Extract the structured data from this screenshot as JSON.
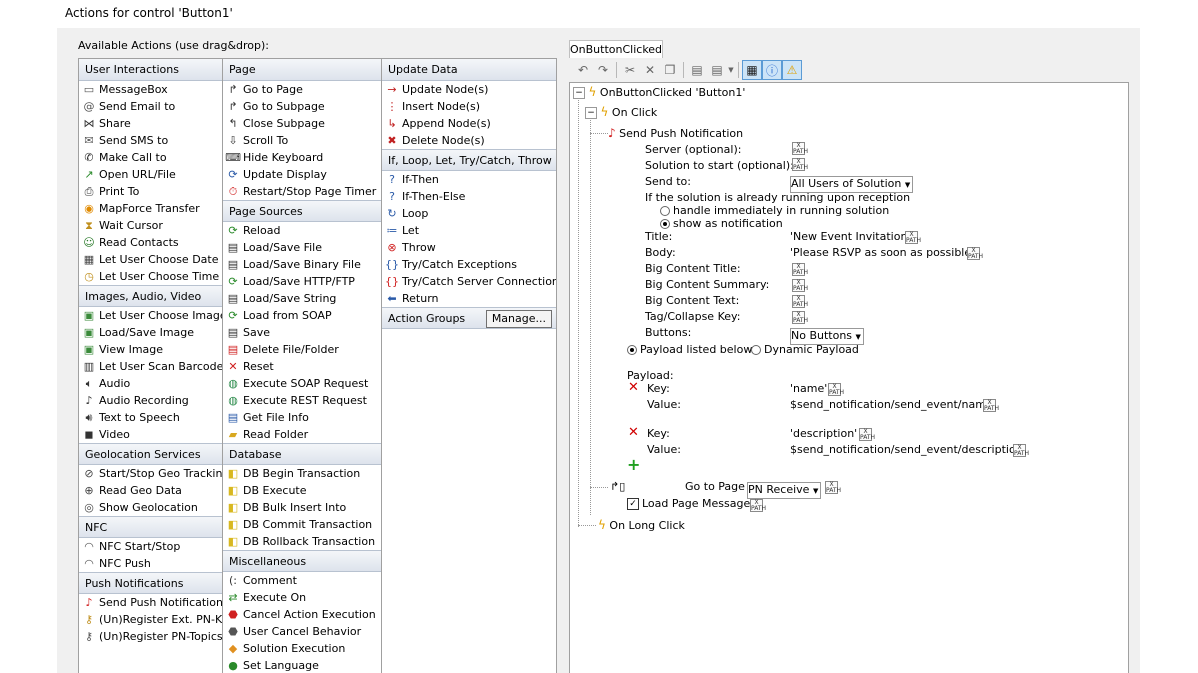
{
  "window_title": "Actions for control 'Button1'",
  "available_label": "Available Actions (use drag&drop):",
  "col1": [
    {
      "type": "group",
      "label": "User Interactions"
    },
    {
      "type": "item",
      "label": "MessageBox",
      "icon": "message-box-icon",
      "glyph": "▭",
      "color": "#555"
    },
    {
      "type": "item",
      "label": "Send Email to",
      "icon": "at-sign-icon",
      "glyph": "@",
      "color": "#555"
    },
    {
      "type": "item",
      "label": "Share",
      "icon": "share-icon",
      "glyph": "⋈",
      "color": "#333"
    },
    {
      "type": "item",
      "label": "Send SMS to",
      "icon": "sms-envelope-icon",
      "glyph": "✉",
      "color": "#555"
    },
    {
      "type": "item",
      "label": "Make Call to",
      "icon": "phone-icon",
      "glyph": "✆",
      "color": "#222"
    },
    {
      "type": "item",
      "label": "Open URL/File",
      "icon": "open-url-icon",
      "glyph": "↗",
      "color": "#2a8a2a"
    },
    {
      "type": "item",
      "label": "Print To",
      "icon": "printer-icon",
      "glyph": "⎙",
      "color": "#333"
    },
    {
      "type": "item",
      "label": "MapForce Transfer",
      "icon": "mapforce-icon",
      "glyph": "◉",
      "color": "#e08a00"
    },
    {
      "type": "item",
      "label": "Wait Cursor",
      "icon": "hourglass-icon",
      "glyph": "⧗",
      "color": "#c09020"
    },
    {
      "type": "item",
      "label": "Read Contacts",
      "icon": "contacts-icon",
      "glyph": "☺",
      "color": "#2a7a2a"
    },
    {
      "type": "item",
      "label": "Let User Choose Date",
      "icon": "calendar-icon",
      "glyph": "▦",
      "color": "#444"
    },
    {
      "type": "item",
      "label": "Let User Choose Time",
      "icon": "clock-icon",
      "glyph": "◷",
      "color": "#c09020"
    },
    {
      "type": "group",
      "label": "Images, Audio, Video"
    },
    {
      "type": "item",
      "label": "Let User Choose Image",
      "icon": "image-icon",
      "glyph": "▣",
      "color": "#3a8a3a"
    },
    {
      "type": "item",
      "label": "Load/Save Image",
      "icon": "image-save-icon",
      "glyph": "▣",
      "color": "#3a8a3a"
    },
    {
      "type": "item",
      "label": "View Image",
      "icon": "view-image-icon",
      "glyph": "▣",
      "color": "#3a8a3a"
    },
    {
      "type": "item",
      "label": "Let User Scan Barcode",
      "icon": "barcode-icon",
      "glyph": "▥",
      "color": "#333"
    },
    {
      "type": "item",
      "label": "Audio",
      "icon": "speaker-icon",
      "glyph": "🔈︎",
      "color": "#333"
    },
    {
      "type": "item",
      "label": "Audio Recording",
      "icon": "microphone-icon",
      "glyph": "♪",
      "color": "#333"
    },
    {
      "type": "item",
      "label": "Text to Speech",
      "icon": "speech-icon",
      "glyph": "🔊︎",
      "color": "#333"
    },
    {
      "type": "item",
      "label": "Video",
      "icon": "video-camera-icon",
      "glyph": "◼",
      "color": "#333"
    },
    {
      "type": "group",
      "label": "Geolocation Services"
    },
    {
      "type": "item",
      "label": "Start/Stop Geo Tracking",
      "icon": "geo-tracking-icon",
      "glyph": "⊘",
      "color": "#444"
    },
    {
      "type": "item",
      "label": "Read Geo Data",
      "icon": "geo-data-icon",
      "glyph": "⊕",
      "color": "#444"
    },
    {
      "type": "item",
      "label": "Show Geolocation",
      "icon": "geolocation-icon",
      "glyph": "◎",
      "color": "#444"
    },
    {
      "type": "group",
      "label": "NFC"
    },
    {
      "type": "item",
      "label": "NFC Start/Stop",
      "icon": "nfc-icon",
      "glyph": "◠",
      "color": "#555"
    },
    {
      "type": "item",
      "label": "NFC Push",
      "icon": "nfc-push-icon",
      "glyph": "◠",
      "color": "#555"
    },
    {
      "type": "group",
      "label": "Push Notifications"
    },
    {
      "type": "item",
      "label": "Send Push Notification",
      "icon": "bell-icon",
      "glyph": "♪",
      "color": "#d02020"
    },
    {
      "type": "item",
      "label": "(Un)Register Ext. PN-Key",
      "icon": "register-key-icon",
      "glyph": "⚷",
      "color": "#c09020"
    },
    {
      "type": "item",
      "label": "(Un)Register PN-Topics",
      "icon": "register-topics-icon",
      "glyph": "⚷",
      "color": "#555"
    }
  ],
  "col2": [
    {
      "type": "group",
      "label": "Page"
    },
    {
      "type": "item",
      "label": "Go to Page",
      "icon": "go-to-page-icon",
      "glyph": "↱",
      "color": "#333"
    },
    {
      "type": "item",
      "label": "Go to Subpage",
      "icon": "go-to-subpage-icon",
      "glyph": "↱",
      "color": "#333"
    },
    {
      "type": "item",
      "label": "Close Subpage",
      "icon": "close-subpage-icon",
      "glyph": "↰",
      "color": "#333"
    },
    {
      "type": "item",
      "label": "Scroll To",
      "icon": "scroll-icon",
      "glyph": "⇩",
      "color": "#333"
    },
    {
      "type": "item",
      "label": "Hide Keyboard",
      "icon": "keyboard-icon",
      "glyph": "⌨",
      "color": "#333"
    },
    {
      "type": "item",
      "label": "Update Display",
      "icon": "update-display-icon",
      "glyph": "⟳",
      "color": "#2a5aa8"
    },
    {
      "type": "item",
      "label": "Restart/Stop Page Timer",
      "icon": "timer-icon",
      "glyph": "⏱",
      "color": "#d02020"
    },
    {
      "type": "group",
      "label": "Page Sources"
    },
    {
      "type": "item",
      "label": "Reload",
      "icon": "reload-icon",
      "glyph": "⟳",
      "color": "#2a8a2a"
    },
    {
      "type": "item",
      "label": "Load/Save File",
      "icon": "save-file-icon",
      "glyph": "▤",
      "color": "#333"
    },
    {
      "type": "item",
      "label": "Load/Save Binary File",
      "icon": "binary-file-icon",
      "glyph": "▤",
      "color": "#333"
    },
    {
      "type": "item",
      "label": "Load/Save HTTP/FTP",
      "icon": "http-icon",
      "glyph": "⟳",
      "color": "#2a8a2a"
    },
    {
      "type": "item",
      "label": "Load/Save String",
      "icon": "string-icon",
      "glyph": "▤",
      "color": "#333"
    },
    {
      "type": "item",
      "label": "Load from SOAP",
      "icon": "soap-icon",
      "glyph": "⟳",
      "color": "#2a8a2a"
    },
    {
      "type": "item",
      "label": "Save",
      "icon": "save-icon",
      "glyph": "▤",
      "color": "#333"
    },
    {
      "type": "item",
      "label": "Delete File/Folder",
      "icon": "delete-file-icon",
      "glyph": "▤",
      "color": "#d02020"
    },
    {
      "type": "item",
      "label": "Reset",
      "icon": "reset-icon",
      "glyph": "✕",
      "color": "#d02020"
    },
    {
      "type": "item",
      "label": "Execute SOAP Request",
      "icon": "globe-icon",
      "glyph": "◍",
      "color": "#2a8a4a"
    },
    {
      "type": "item",
      "label": "Execute REST Request",
      "icon": "globe-rest-icon",
      "glyph": "◍",
      "color": "#2a8a4a"
    },
    {
      "type": "item",
      "label": "Get File Info",
      "icon": "file-info-icon",
      "glyph": "▤",
      "color": "#2a5aa8"
    },
    {
      "type": "item",
      "label": "Read Folder",
      "icon": "folder-icon",
      "glyph": "▰",
      "color": "#d8a820"
    },
    {
      "type": "group",
      "label": "Database"
    },
    {
      "type": "item",
      "label": "DB Begin Transaction",
      "icon": "db-begin-icon",
      "glyph": "◧",
      "color": "#d8b820"
    },
    {
      "type": "item",
      "label": "DB Execute",
      "icon": "db-execute-icon",
      "glyph": "◧",
      "color": "#d8b820"
    },
    {
      "type": "item",
      "label": "DB Bulk Insert Into",
      "icon": "db-bulk-icon",
      "glyph": "◧",
      "color": "#d8b820"
    },
    {
      "type": "item",
      "label": "DB Commit Transaction",
      "icon": "db-commit-icon",
      "glyph": "◧",
      "color": "#d8b820"
    },
    {
      "type": "item",
      "label": "DB Rollback Transaction",
      "icon": "db-rollback-icon",
      "glyph": "◧",
      "color": "#d8b820"
    },
    {
      "type": "group",
      "label": "Miscellaneous"
    },
    {
      "type": "item",
      "label": "Comment",
      "icon": "comment-icon",
      "glyph": "(:",
      "color": "#333"
    },
    {
      "type": "item",
      "label": "Execute On",
      "icon": "execute-on-icon",
      "glyph": "⇄",
      "color": "#2a8a2a"
    },
    {
      "type": "item",
      "label": "Cancel Action Execution",
      "icon": "cancel-icon",
      "glyph": "⬣",
      "color": "#d02020"
    },
    {
      "type": "item",
      "label": "User Cancel Behavior",
      "icon": "user-cancel-icon",
      "glyph": "⬣",
      "color": "#555"
    },
    {
      "type": "item",
      "label": "Solution Execution",
      "icon": "solution-icon",
      "glyph": "◆",
      "color": "#e09020"
    },
    {
      "type": "item",
      "label": "Set Language",
      "icon": "language-icon",
      "glyph": "●",
      "color": "#2a8a2a"
    }
  ],
  "col3": [
    {
      "type": "group",
      "label": "Update Data"
    },
    {
      "type": "item",
      "label": "Update Node(s)",
      "icon": "update-node-icon",
      "glyph": "→",
      "color": "#c02020"
    },
    {
      "type": "item",
      "label": "Insert Node(s)",
      "icon": "insert-node-icon",
      "glyph": "⋮",
      "color": "#c02020"
    },
    {
      "type": "item",
      "label": "Append Node(s)",
      "icon": "append-node-icon",
      "glyph": "↳",
      "color": "#c02020"
    },
    {
      "type": "item",
      "label": "Delete Node(s)",
      "icon": "delete-node-icon",
      "glyph": "✖",
      "color": "#c02020"
    },
    {
      "type": "group",
      "label": "If, Loop, Let, Try/Catch, Throw"
    },
    {
      "type": "item",
      "label": "If-Then",
      "icon": "question-icon",
      "glyph": "?",
      "color": "#2a5aa8"
    },
    {
      "type": "item",
      "label": "If-Then-Else",
      "icon": "question-else-icon",
      "glyph": "?",
      "color": "#2a5aa8"
    },
    {
      "type": "item",
      "label": "Loop",
      "icon": "loop-icon",
      "glyph": "↻",
      "color": "#2a5aa8"
    },
    {
      "type": "item",
      "label": "Let",
      "icon": "let-icon",
      "glyph": "≔",
      "color": "#2a5aa8"
    },
    {
      "type": "item",
      "label": "Throw",
      "icon": "throw-icon",
      "glyph": "⊗",
      "color": "#d02020"
    },
    {
      "type": "item",
      "label": "Try/Catch Exceptions",
      "icon": "try-catch-icon",
      "glyph": "{}",
      "color": "#2a5aa8"
    },
    {
      "type": "item",
      "label": "Try/Catch Server Connection",
      "icon": "try-catch-server-icon",
      "glyph": "{}",
      "color": "#d02020"
    },
    {
      "type": "item",
      "label": "Return",
      "icon": "return-icon",
      "glyph": "⬅",
      "color": "#2a5aa8"
    },
    {
      "type": "group",
      "label": "Action Groups",
      "button": "Manage..."
    }
  ],
  "editor": {
    "tab": "OnButtonClicked",
    "root": "OnButtonClicked 'Button1'",
    "on_click": "On Click",
    "send_push": "Send Push Notification",
    "server_label": "Server (optional):",
    "solution_label": "Solution to start (optional):",
    "send_to_label": "Send to:",
    "send_to_value": "All Users of Solution",
    "running_label": "If the solution is already running upon reception",
    "handle_label": "handle immediately in running solution",
    "show_label": "show as notification",
    "title_label": "Title:",
    "title_value": "'New Event Invitation'",
    "body_label": "Body:",
    "body_value": "'Please RSVP as soon as possible.'",
    "big_title_label": "Big Content Title:",
    "big_summary_label": "Big Content Summary:",
    "big_text_label": "Big Content Text:",
    "tag_label": "Tag/Collapse Key:",
    "buttons_label": "Buttons:",
    "buttons_value": "No Buttons",
    "payload_below": "Payload listed below",
    "dynamic_payload": "Dynamic Payload",
    "payload_label": "Payload:",
    "key_label": "Key:",
    "value_label": "Value:",
    "key1": "'name'",
    "value1": "$send_notification/send_event/name",
    "key2": "'description'",
    "value2": "$send_notification/send_event/description",
    "goto_label": "Go to Page",
    "goto_value": "PN Receive",
    "load_msg": "Load Page Message",
    "on_long_click": "On Long Click",
    "xpath_top": "X",
    "xpath_bottom": "PATH",
    "plus": "+",
    "dropdown_arrow": "▼"
  }
}
